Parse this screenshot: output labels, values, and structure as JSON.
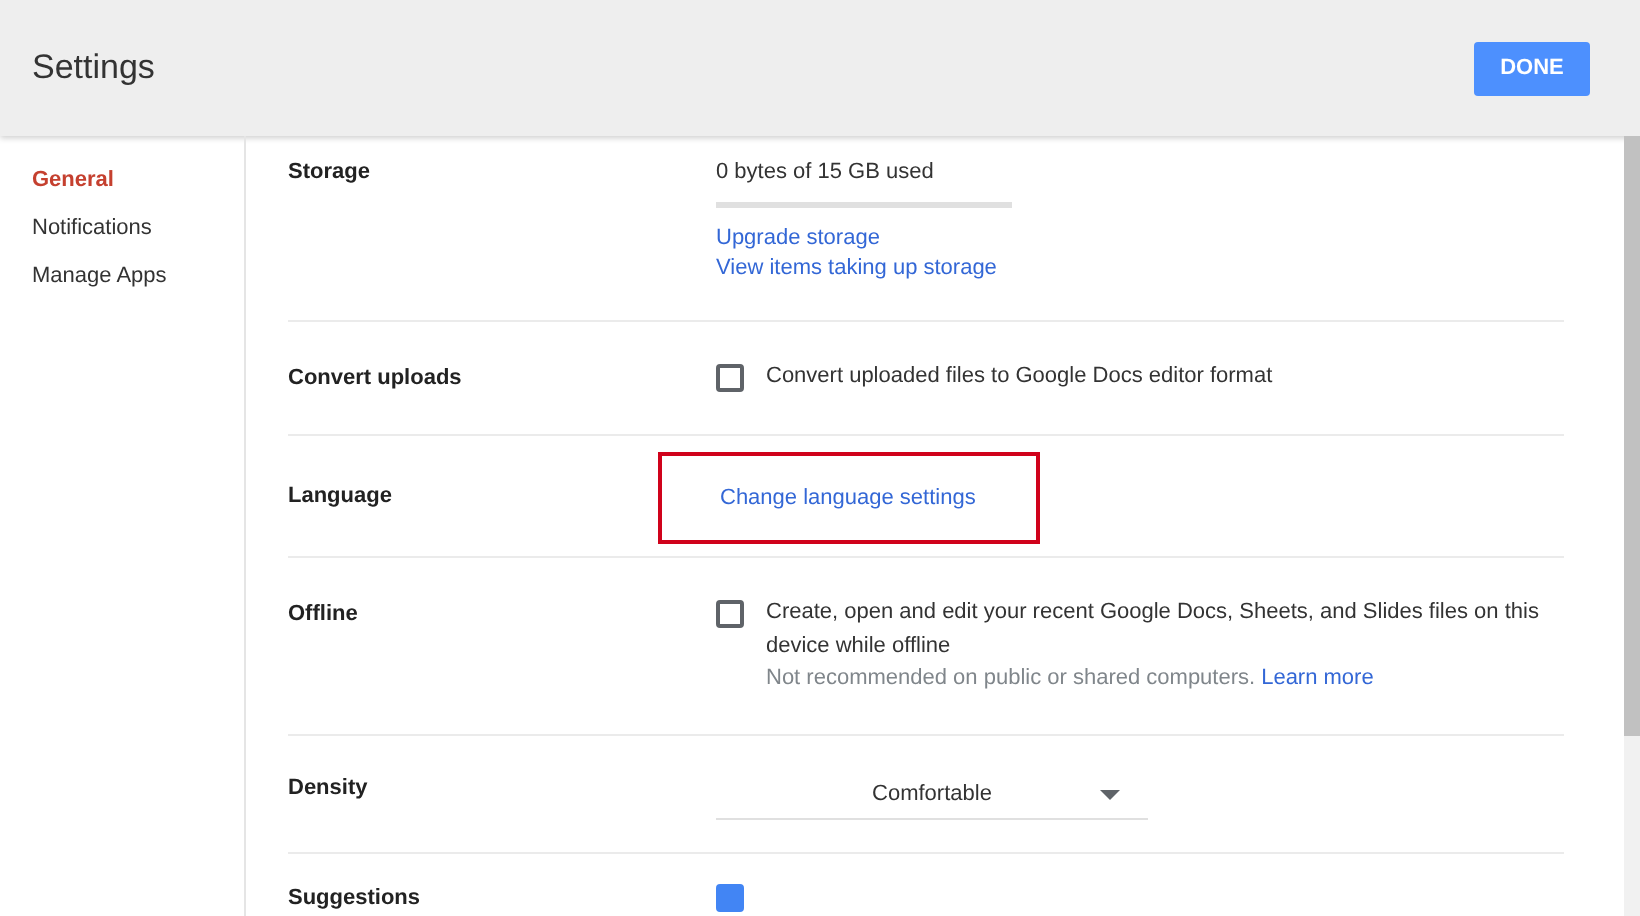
{
  "header": {
    "title": "Settings",
    "done_button": "DONE"
  },
  "sidebar": {
    "items": [
      {
        "label": "General",
        "selected": true
      },
      {
        "label": "Notifications",
        "selected": false
      },
      {
        "label": "Manage Apps",
        "selected": false
      }
    ]
  },
  "sections": [
    {
      "kind": "storage",
      "label": "Storage",
      "usage": "0 bytes of 15 GB used",
      "level": 0,
      "links": [
        "Upgrade storage",
        "View items taking up storage"
      ]
    },
    {
      "kind": "checkbox",
      "label": "Convert uploads",
      "checked": false,
      "text": "Convert uploaded files to Google Docs editor format"
    },
    {
      "kind": "link",
      "label": "Language",
      "link": "Change language settings",
      "highlighted": true
    },
    {
      "kind": "checkbox",
      "label": "Offline",
      "checked": false,
      "text": "Create, open and edit your recent Google Docs, Sheets, and Slides files on this device while offline",
      "note": "Not recommended on public or shared computers.",
      "note_link": "Learn more"
    },
    {
      "kind": "select",
      "label": "Density",
      "value": "Comfortable"
    },
    {
      "kind": "checkbox",
      "label": "Suggestions",
      "checked": true
    }
  ]
}
